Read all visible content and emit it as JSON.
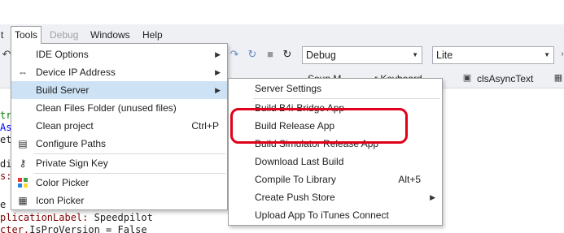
{
  "menubar": {
    "cut_item": "t",
    "items": [
      {
        "label": "Tools"
      },
      {
        "label": "Debug"
      },
      {
        "label": "Windows"
      },
      {
        "label": "Help"
      }
    ]
  },
  "toolbar": {
    "config_combo": "Debug",
    "mode_combo": "Lite"
  },
  "tabs": {
    "partial_1": "Soun M",
    "partial_2": "r Keyboard",
    "class_tab": "clsAsyncText"
  },
  "code": {
    "lines": [
      {
        "kw": "tre",
        "rest": ""
      },
      {
        "kw": "As",
        "rest": ""
      },
      {
        "kw": "etF",
        "rest": ""
      },
      {
        "kw": "",
        "rest": ""
      },
      {
        "kw": "dit",
        "rest": ""
      },
      {
        "kw": "s:",
        "rest": ""
      },
      {
        "kw": "",
        "rest": ""
      },
      {
        "kw": "e",
        "rest": ""
      },
      {
        "kw": "plicationLabel:",
        "rest": " Speedpilot"
      },
      {
        "kw": "cter.",
        "rest": "IsProVersion = False"
      }
    ]
  },
  "tools_menu": {
    "items": [
      {
        "label": "IDE Options",
        "icon": "",
        "has_submenu": true
      },
      {
        "label": "Device IP Address",
        "icon": "link-icon",
        "has_submenu": true
      },
      {
        "label": "Build Server",
        "icon": "",
        "has_submenu": true,
        "highlighted": true
      },
      {
        "label": "Clean Files Folder (unused files)",
        "icon": ""
      },
      {
        "label": "Clean project",
        "icon": "",
        "shortcut": "Ctrl+P"
      },
      {
        "label": "Configure Paths",
        "icon": "document-icon"
      },
      {
        "label": "Private Sign Key",
        "icon": "key-icon"
      },
      {
        "label": "Color Picker",
        "icon": "color-picker-icon"
      },
      {
        "label": "Icon Picker",
        "icon": "icon-picker-icon"
      }
    ]
  },
  "build_server_menu": {
    "items": [
      {
        "label": "Server Settings"
      },
      {
        "label": "Build B4i-Bridge App"
      },
      {
        "label": "Build Release App"
      },
      {
        "label": "Build Simulator Release App"
      },
      {
        "label": "Download Last Build"
      },
      {
        "label": "Compile To Library",
        "shortcut": "Alt+5"
      },
      {
        "label": "Create Push Store",
        "has_submenu": true
      },
      {
        "label": "Upload App To iTunes Connect"
      }
    ]
  },
  "annotation": {
    "color": "#e0001a",
    "target": "Build Release App"
  },
  "colors": {
    "highlight": "#cde2f5",
    "menubar_bg": "#eef0f4"
  }
}
